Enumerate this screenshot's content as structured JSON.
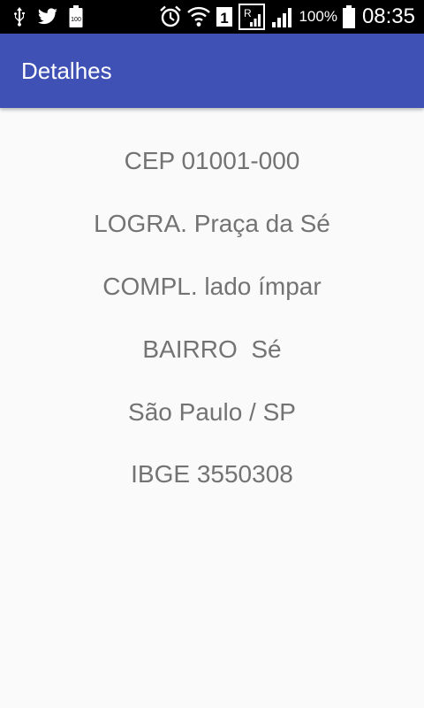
{
  "status_bar": {
    "icons": [
      "usb-icon",
      "twitter-icon",
      "battery-full-notification-icon",
      "alarm-icon",
      "wifi-icon",
      "sim-1-icon",
      "signal-roaming-icon",
      "signal-icon",
      "battery-icon"
    ],
    "battery_percent": "100%",
    "time": "08:35",
    "sim_label": "1",
    "battery_notification_label": "100"
  },
  "toolbar": {
    "title": "Detalhes",
    "color": "#3f51b5"
  },
  "details": {
    "cep": "CEP 01001-000",
    "logradouro": "LOGRA. Praça da Sé",
    "complemento": "COMPL. lado ímpar",
    "bairro": "BAIRRO  Sé",
    "cidade_uf": "São Paulo / SP",
    "ibge": "IBGE 3550308"
  },
  "colors": {
    "background": "#fafafa",
    "text": "#737373",
    "status_bar": "#000000"
  }
}
